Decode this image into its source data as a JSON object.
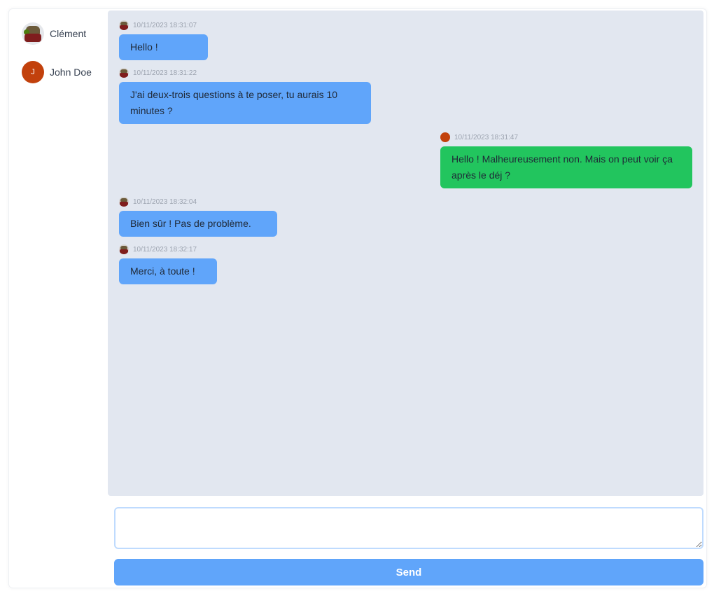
{
  "contacts": [
    {
      "name": "Clément",
      "avatar": "photo-avatar"
    },
    {
      "name": "John Doe",
      "avatar": "initial-avatar",
      "initial": "J"
    }
  ],
  "messages": [
    {
      "direction": "incoming",
      "timestamp": "10/11/2023 18:31:07",
      "text": "Hello !"
    },
    {
      "direction": "incoming",
      "timestamp": "10/11/2023 18:31:22",
      "text": "J'ai deux-trois questions à te poser, tu aurais 10 minutes ?"
    },
    {
      "direction": "outgoing",
      "timestamp": "10/11/2023 18:31:47",
      "text": "Hello ! Malheureusement non. Mais on peut voir ça après le déj ?"
    },
    {
      "direction": "incoming",
      "timestamp": "10/11/2023 18:32:04",
      "text": "Bien sûr ! Pas de problème."
    },
    {
      "direction": "incoming",
      "timestamp": "10/11/2023 18:32:17",
      "text": "Merci, à toute !"
    }
  ],
  "composer": {
    "value": "",
    "placeholder": ""
  },
  "send_label": "Send",
  "colors": {
    "incoming_bubble": "#60a5fa",
    "outgoing_bubble": "#22c55e",
    "chat_background": "#e2e7f0",
    "send_button": "#60a5fa"
  }
}
